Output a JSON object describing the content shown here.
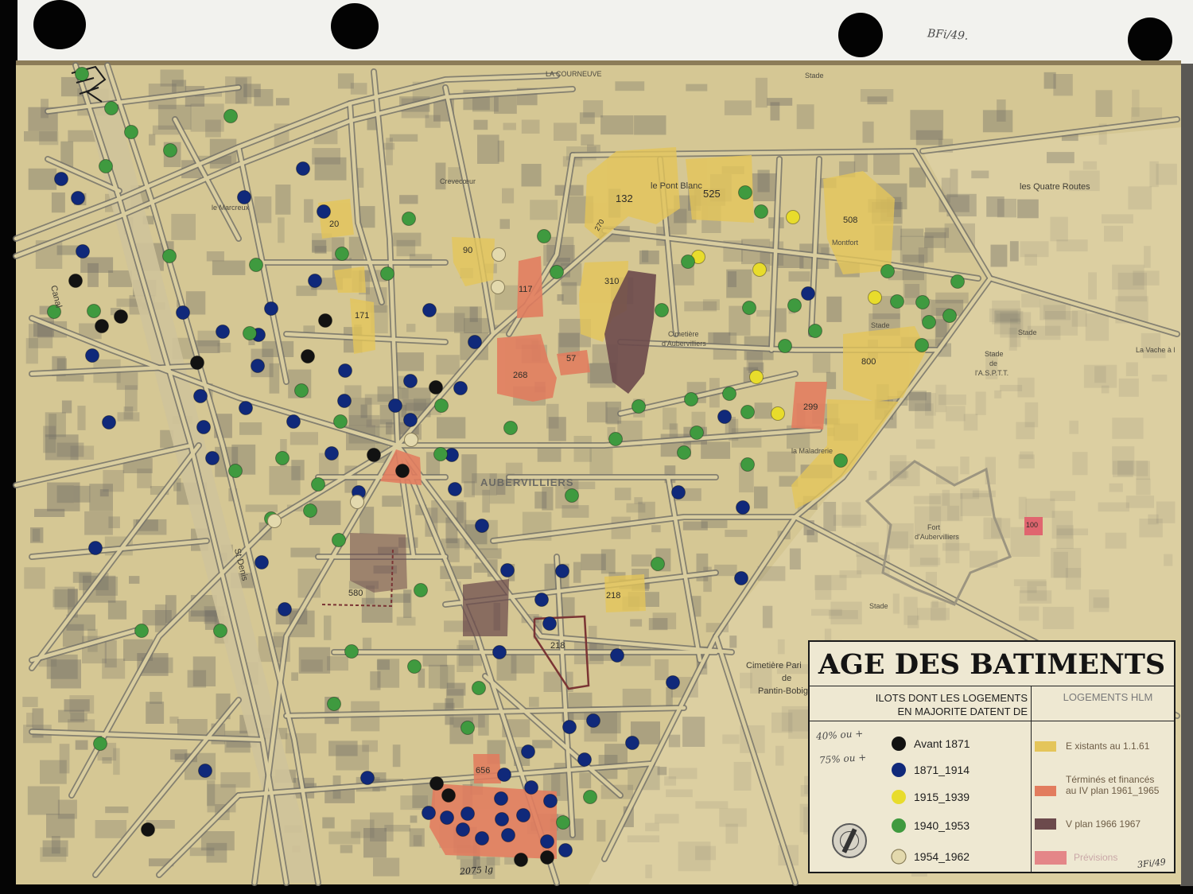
{
  "annotations": {
    "top_ref": "BFi/49.",
    "bottom_note": "2075 lg"
  },
  "places": {
    "la_courneuve": "LA COURNEUVE",
    "stade_north": "Stade",
    "crevecoeur": "Crevecœur",
    "le_marcreux": "le Marcreux",
    "le_pont_blanc": "le Pont Blanc",
    "les_quatre_routes": "les Quatre Routes",
    "montfort": "Montfort",
    "cimetiere_aub_1": "Cimetière",
    "cimetiere_aub_2": "d'Aubervilliers",
    "stade_center": "Stade",
    "stade_asptt_1": "Stade",
    "stade_asptt_2": "de",
    "stade_asptt_3": "l'A.S.P.T.T.",
    "stade_east": "Stade",
    "la_vache": "La Vache à l",
    "la_maladrerie": "la Maladrerie",
    "aubervilliers": "AUBERVILLIERS",
    "fort_1": "Fort",
    "fort_2": "d'Aubervilliers",
    "stade_south": "Stade",
    "canal": "Canal",
    "st_denis": "St Denis",
    "cimetiere_par_1": "Cimetière Pari",
    "cimetiere_par_2": "de",
    "cimetiere_par_3": "Pantin-Bobig"
  },
  "block_numbers": {
    "b20": "20",
    "b270": "270",
    "b132": "132",
    "b525": "525",
    "b508": "508",
    "b90": "90",
    "b117": "117",
    "b310": "310",
    "b171": "171",
    "b268": "268",
    "b57": "57",
    "b800": "800",
    "b299": "299",
    "b580": "580",
    "b218_east": "218",
    "b218_south": "218",
    "b656": "656",
    "b100": "100"
  },
  "legend": {
    "title": "AGE DES BATIMENTS",
    "age_header": [
      "ILOTS DONT LES LOGEMENTS",
      "EN MAJORITE DATENT DE"
    ],
    "hlm_header": "LOGEMENTS HLM",
    "handwritten_notes": [
      "40% ou +",
      "75% ou +"
    ],
    "age_classes": [
      {
        "label": "Avant 1871",
        "color": "#121212"
      },
      {
        "label": "1871_1914",
        "color": "#10297a"
      },
      {
        "label": "1915_1939",
        "color": "#e8dc2c"
      },
      {
        "label": "1940_1953",
        "color": "#3f9a3f"
      },
      {
        "label": "1954_1962",
        "color": "#e3d9ad"
      }
    ],
    "hlm_classes": [
      {
        "label": "E xistants au 1.1.61",
        "color": "#e4c55a"
      },
      {
        "label_lines": [
          "Términés et financés",
          "au IV plan 1961_1965"
        ],
        "color": "#e27c5e"
      },
      {
        "label": "V plan 1966 1967",
        "color": "#6c4a4c"
      },
      {
        "label": "Prévisions",
        "color": "#e0656f"
      }
    ],
    "archive_ref": "3Fi/49"
  }
}
